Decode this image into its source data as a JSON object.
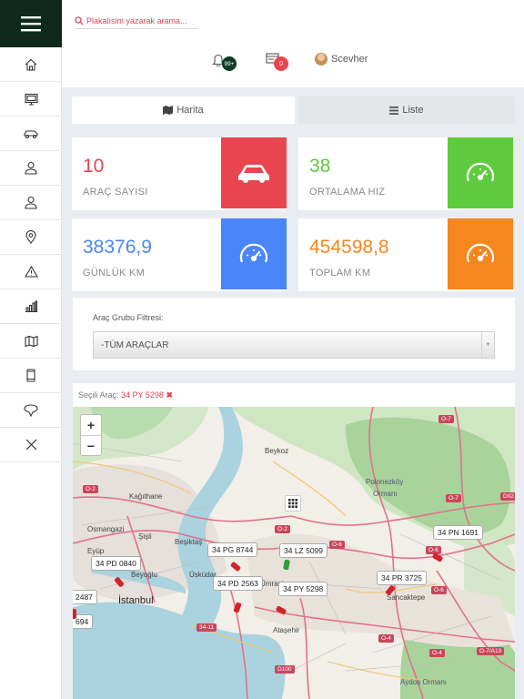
{
  "header": {
    "search_placeholder": "Plakalısim yazarak arama...",
    "notifications_count": "99+",
    "messages_count": "0",
    "username": "Scevher"
  },
  "tabs": [
    {
      "label": "Harita",
      "icon": "map-icon",
      "active": true
    },
    {
      "label": "Liste",
      "icon": "list-icon",
      "active": false
    }
  ],
  "stats": [
    {
      "value": "10",
      "label": "ARAÇ SAYISI",
      "color": "#e8454f",
      "icon": "car-icon"
    },
    {
      "value": "38",
      "label": "ORTALAMA HIZ",
      "color": "#5dcb3d",
      "icon": "speedometer-icon"
    },
    {
      "value": "38376,9",
      "label": "GÜNLÜK KM",
      "color": "#4a86f5",
      "icon": "speedometer-icon"
    },
    {
      "value": "454598,8",
      "label": "TOPLAM KM",
      "color": "#f5871e",
      "icon": "speedometer-icon"
    }
  ],
  "filter": {
    "label": "Araç Grubu Filtresi:",
    "selected": "-TÜM ARAÇLAR"
  },
  "map_panel": {
    "selected_prefix": "Seçili Araç:",
    "selected_plate": "34 PY 5298",
    "zoom_in": "+",
    "zoom_out": "−"
  },
  "vehicles": [
    {
      "plate": "34 PG 8744"
    },
    {
      "plate": "34 LZ 5099"
    },
    {
      "plate": "34 PD 0840"
    },
    {
      "plate": "34 PD 2563"
    },
    {
      "plate": "34 PY 5298"
    },
    {
      "plate": "34 PR 3725"
    },
    {
      "plate": "34 PN 1691"
    },
    {
      "plate": "2487"
    },
    {
      "plate": "694"
    }
  ],
  "map_places": [
    "Beykoz",
    "Kağıthane",
    "Polonezköy",
    "Ormanı",
    "Osmangazi",
    "Şişli",
    "Beşiktaş",
    "Eyüp",
    "Beyoğlu",
    "Üsküdar",
    "İstanbul",
    "Ataşehir",
    "Sancaktepe",
    "Aydos Ormanı",
    "Ümraniye"
  ],
  "road_badges": [
    "O-7",
    "O-2",
    "O-2",
    "O-6",
    "O-6",
    "O-6",
    "O-7",
    "D02",
    "34-11",
    "O-4",
    "O-4",
    "O-7/A13",
    "D100"
  ]
}
